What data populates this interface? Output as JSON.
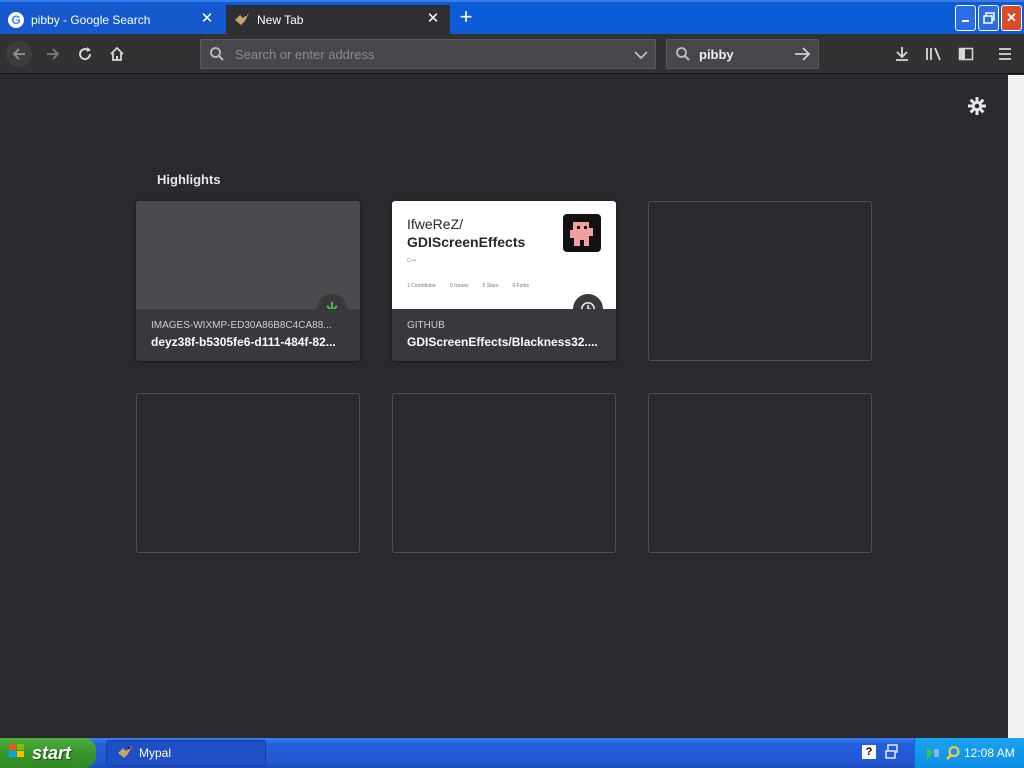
{
  "browser": {
    "tabs": [
      {
        "label": "pibby - Google Search",
        "favicon": "google-icon",
        "active": false
      },
      {
        "label": "New Tab",
        "favicon": "mypal-bird-icon",
        "active": true
      }
    ],
    "urlbar": {
      "placeholder": "Search or enter address",
      "value": ""
    },
    "searchbar": {
      "value": "pibby"
    }
  },
  "newtab": {
    "highlights_title": "Highlights",
    "cards": [
      {
        "source": "IMAGES-WIXMP-ED30A86B8C4CA88...",
        "title": "deyz38f-b5305fe6-d111-484f-82...",
        "badge_icon": "download-icon"
      },
      {
        "source": "GITHUB",
        "title": "GDIScreenEffects/Blackness32....",
        "badge_icon": "clock-icon",
        "preview": {
          "owner": "IfweReZ/",
          "repo": "GDIScreenEffects",
          "language": "C++",
          "stats": [
            {
              "num": "1",
              "label": "Contributor"
            },
            {
              "num": "0",
              "label": "Issues"
            },
            {
              "num": "5",
              "label": "Stars"
            },
            {
              "num": "0",
              "label": "Forks"
            }
          ]
        }
      }
    ]
  },
  "taskbar": {
    "start_label": "start",
    "task_label": "Mypal",
    "clock": "12:08 AM"
  },
  "colors": {
    "accent_blue": "#0b5ad6",
    "content_bg": "#2a2a2e",
    "download_green": "#3fc23f",
    "start_green": "#3c9a2f"
  }
}
